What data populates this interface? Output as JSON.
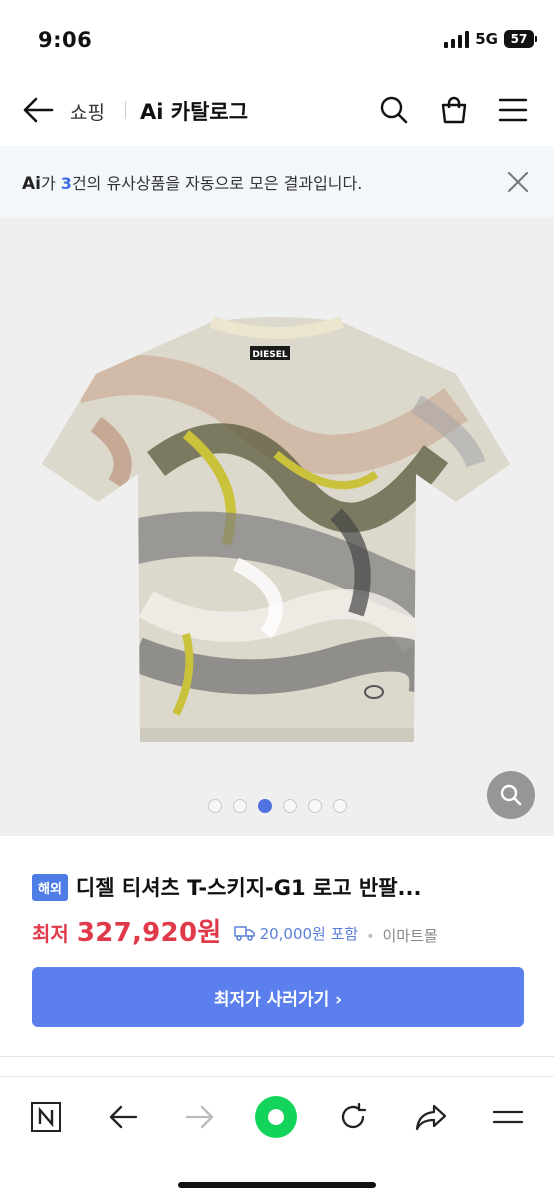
{
  "status": {
    "time": "9:06",
    "network": "5G",
    "battery": "57"
  },
  "header": {
    "breadcrumb_shop": "쇼핑",
    "title": "Ai 카탈로그"
  },
  "banner": {
    "ai_mark": "Ai",
    "prefix": "가 ",
    "count": "3",
    "suffix": "건의 유사상품을 자동으로 모은 결과입니다."
  },
  "gallery": {
    "total_images": 6,
    "active_index": 2,
    "brand_tag": "DIESEL"
  },
  "product": {
    "badge": "해외",
    "title": "디젤 티셔츠 T-스키지-G1 로고 반팔...",
    "price_label": "최저",
    "price": "327,920원",
    "shipping": "20,000원 포함",
    "separator": "•",
    "mall": "이마트몰",
    "buy_label": "최저가 사러가기 ›"
  },
  "colors": {
    "accent": "#5b80ee",
    "price_red": "#e0394a",
    "badge_blue": "#4f7de8",
    "shipping_blue": "#5b7ed8"
  },
  "bottom_bar": {
    "icons": [
      "naver-n-icon",
      "back-arrow-icon",
      "forward-arrow-icon",
      "green-home-icon",
      "refresh-icon",
      "share-icon",
      "menu-icon"
    ]
  }
}
